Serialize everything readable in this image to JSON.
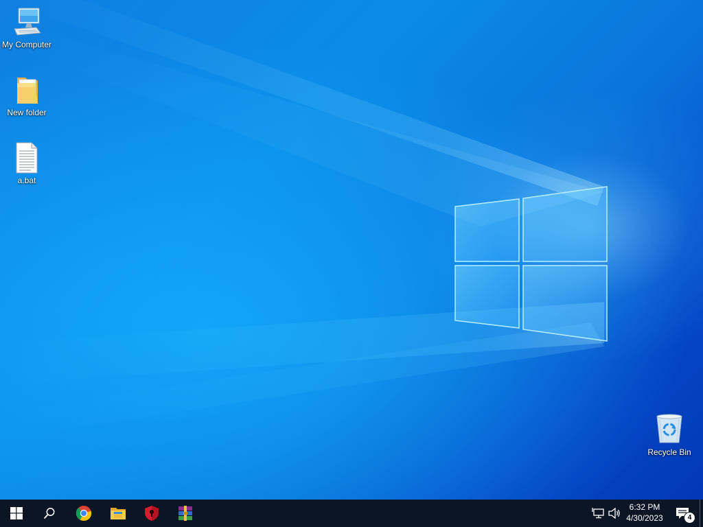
{
  "desktop": {
    "icons": [
      {
        "label": "My Computer",
        "icon": "computer-icon"
      },
      {
        "label": "New folder",
        "icon": "folder-icon"
      },
      {
        "label": "a.bat",
        "icon": "batch-file-icon"
      },
      {
        "label": "Recycle Bin",
        "icon": "recycle-bin-icon"
      }
    ]
  },
  "taskbar": {
    "pinned": [
      {
        "icon": "start-windows-icon"
      },
      {
        "icon": "search-icon"
      },
      {
        "icon": "chrome-icon"
      },
      {
        "icon": "file-explorer-icon"
      },
      {
        "icon": "security-shield-icon"
      },
      {
        "icon": "winrar-icon"
      }
    ],
    "tray": {
      "network_icon": "network-icon",
      "volume_icon": "volume-icon",
      "time": "6:32 PM",
      "date": "4/30/2023",
      "notification_count": "4"
    }
  },
  "colors": {
    "taskbar_bg": "#0b1524",
    "wallpaper_accent": "#0a74dc"
  }
}
